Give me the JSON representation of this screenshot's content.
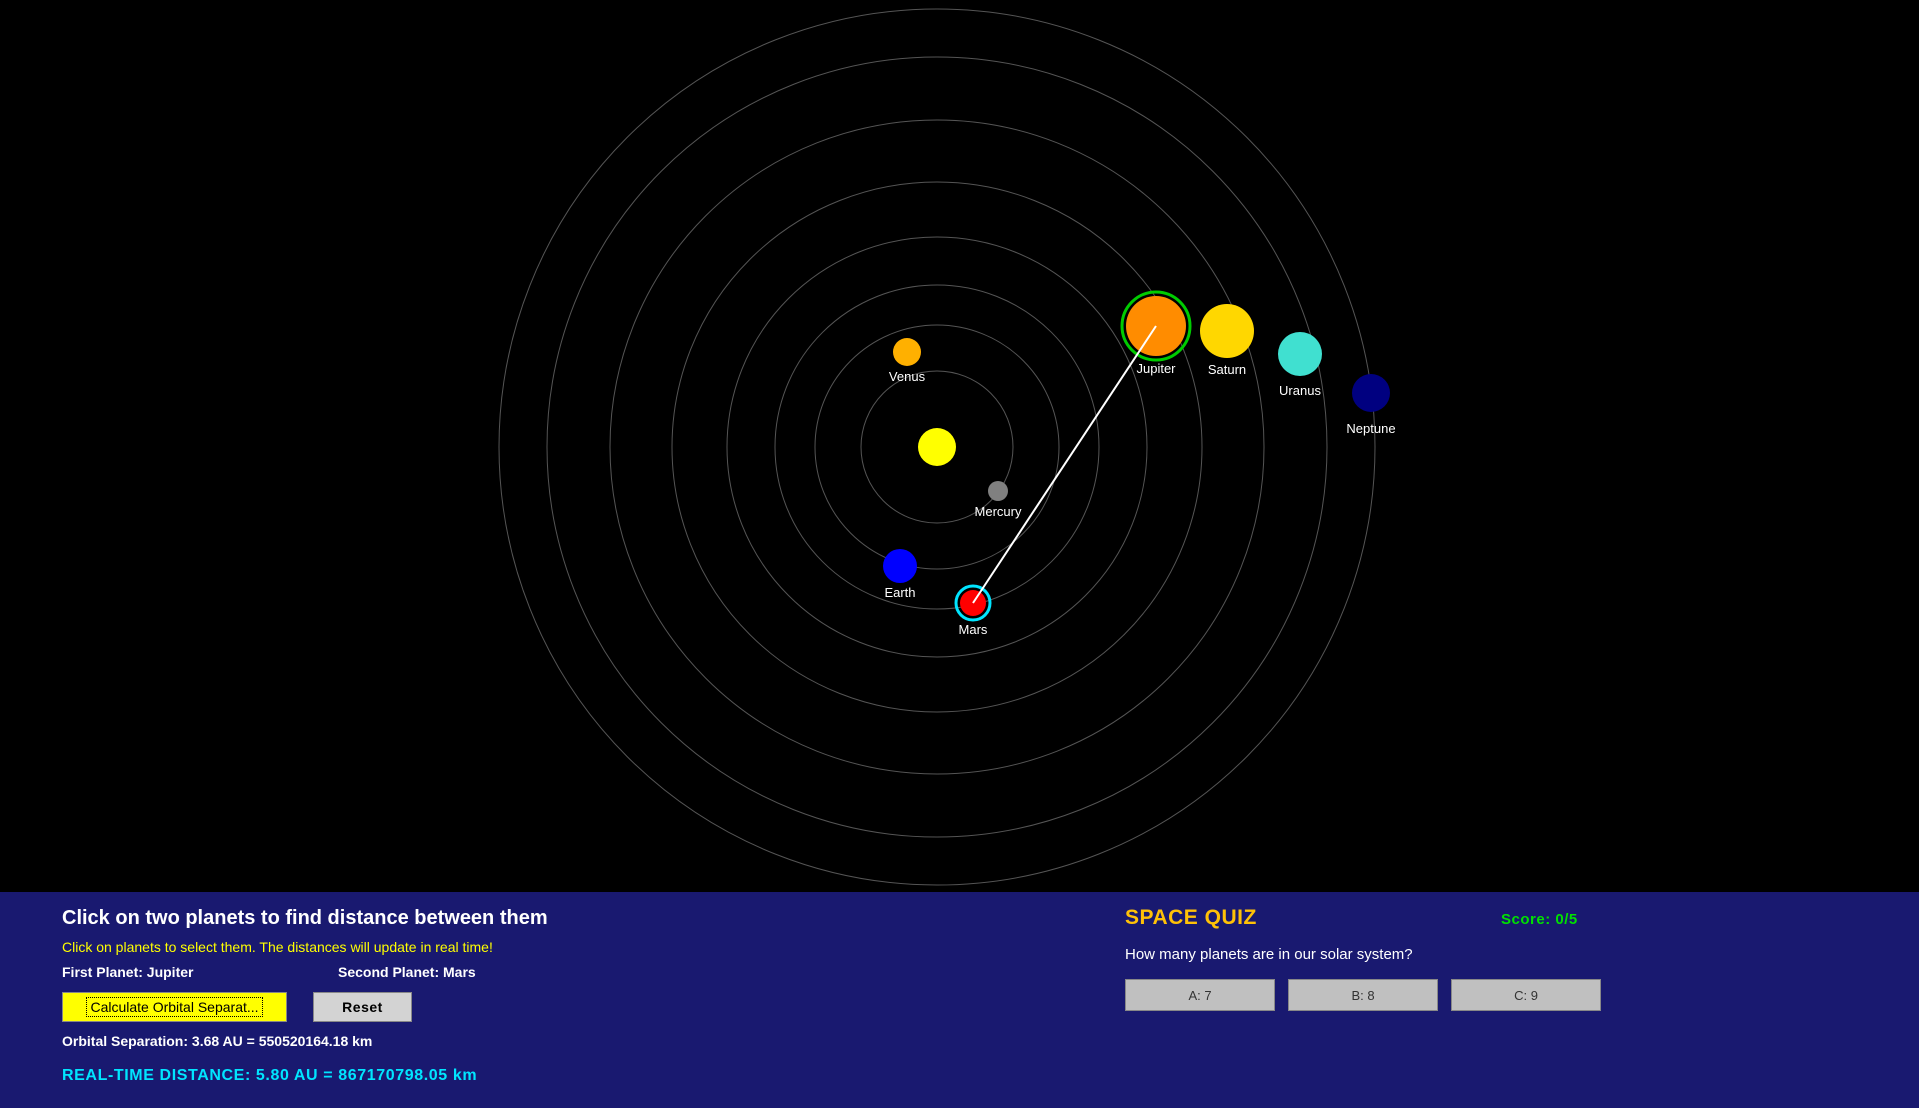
{
  "scene": {
    "sun": {
      "color": "#ffff00",
      "name": "sun"
    },
    "orbits": [
      1,
      2,
      3,
      4,
      5,
      6,
      7,
      8
    ],
    "planets": [
      {
        "name": "Mercury",
        "color": "#808080"
      },
      {
        "name": "Venus",
        "color": "#ffb000"
      },
      {
        "name": "Earth",
        "color": "#0000ff"
      },
      {
        "name": "Mars",
        "color": "#ff0000",
        "selected": "second"
      },
      {
        "name": "Jupiter",
        "color": "#ff8c00",
        "selected": "first"
      },
      {
        "name": "Saturn",
        "color": "#ffd700"
      },
      {
        "name": "Uranus",
        "color": "#40e0d0"
      },
      {
        "name": "Neptune",
        "color": "#000080"
      }
    ],
    "selection_colors": {
      "first": "#00cc00",
      "second": "#00e5ff",
      "line": "#ffffff"
    }
  },
  "panel": {
    "title": "Click on two planets to find distance between them",
    "hint": "Click on planets to select them. The distances will update in real time!",
    "first_planet": "First Planet: Jupiter",
    "second_planet": "Second Planet: Mars",
    "calculate_label": "Calculate Orbital Separat...",
    "reset_label": "Reset",
    "orbital_separation": "Orbital Separation: 3.68 AU = 550520164.18 km",
    "realtime_distance": "REAL-TIME DISTANCE: 5.80 AU = 867170798.05 km"
  },
  "quiz": {
    "title": "SPACE QUIZ",
    "score": "Score: 0/5",
    "question": "How many planets are in our solar system?",
    "options": [
      "A: 7",
      "B: 8",
      "C: 9"
    ]
  },
  "colors": {
    "background": "#000000",
    "panel_bg": "#191970",
    "orbit_stroke": "#555555"
  }
}
